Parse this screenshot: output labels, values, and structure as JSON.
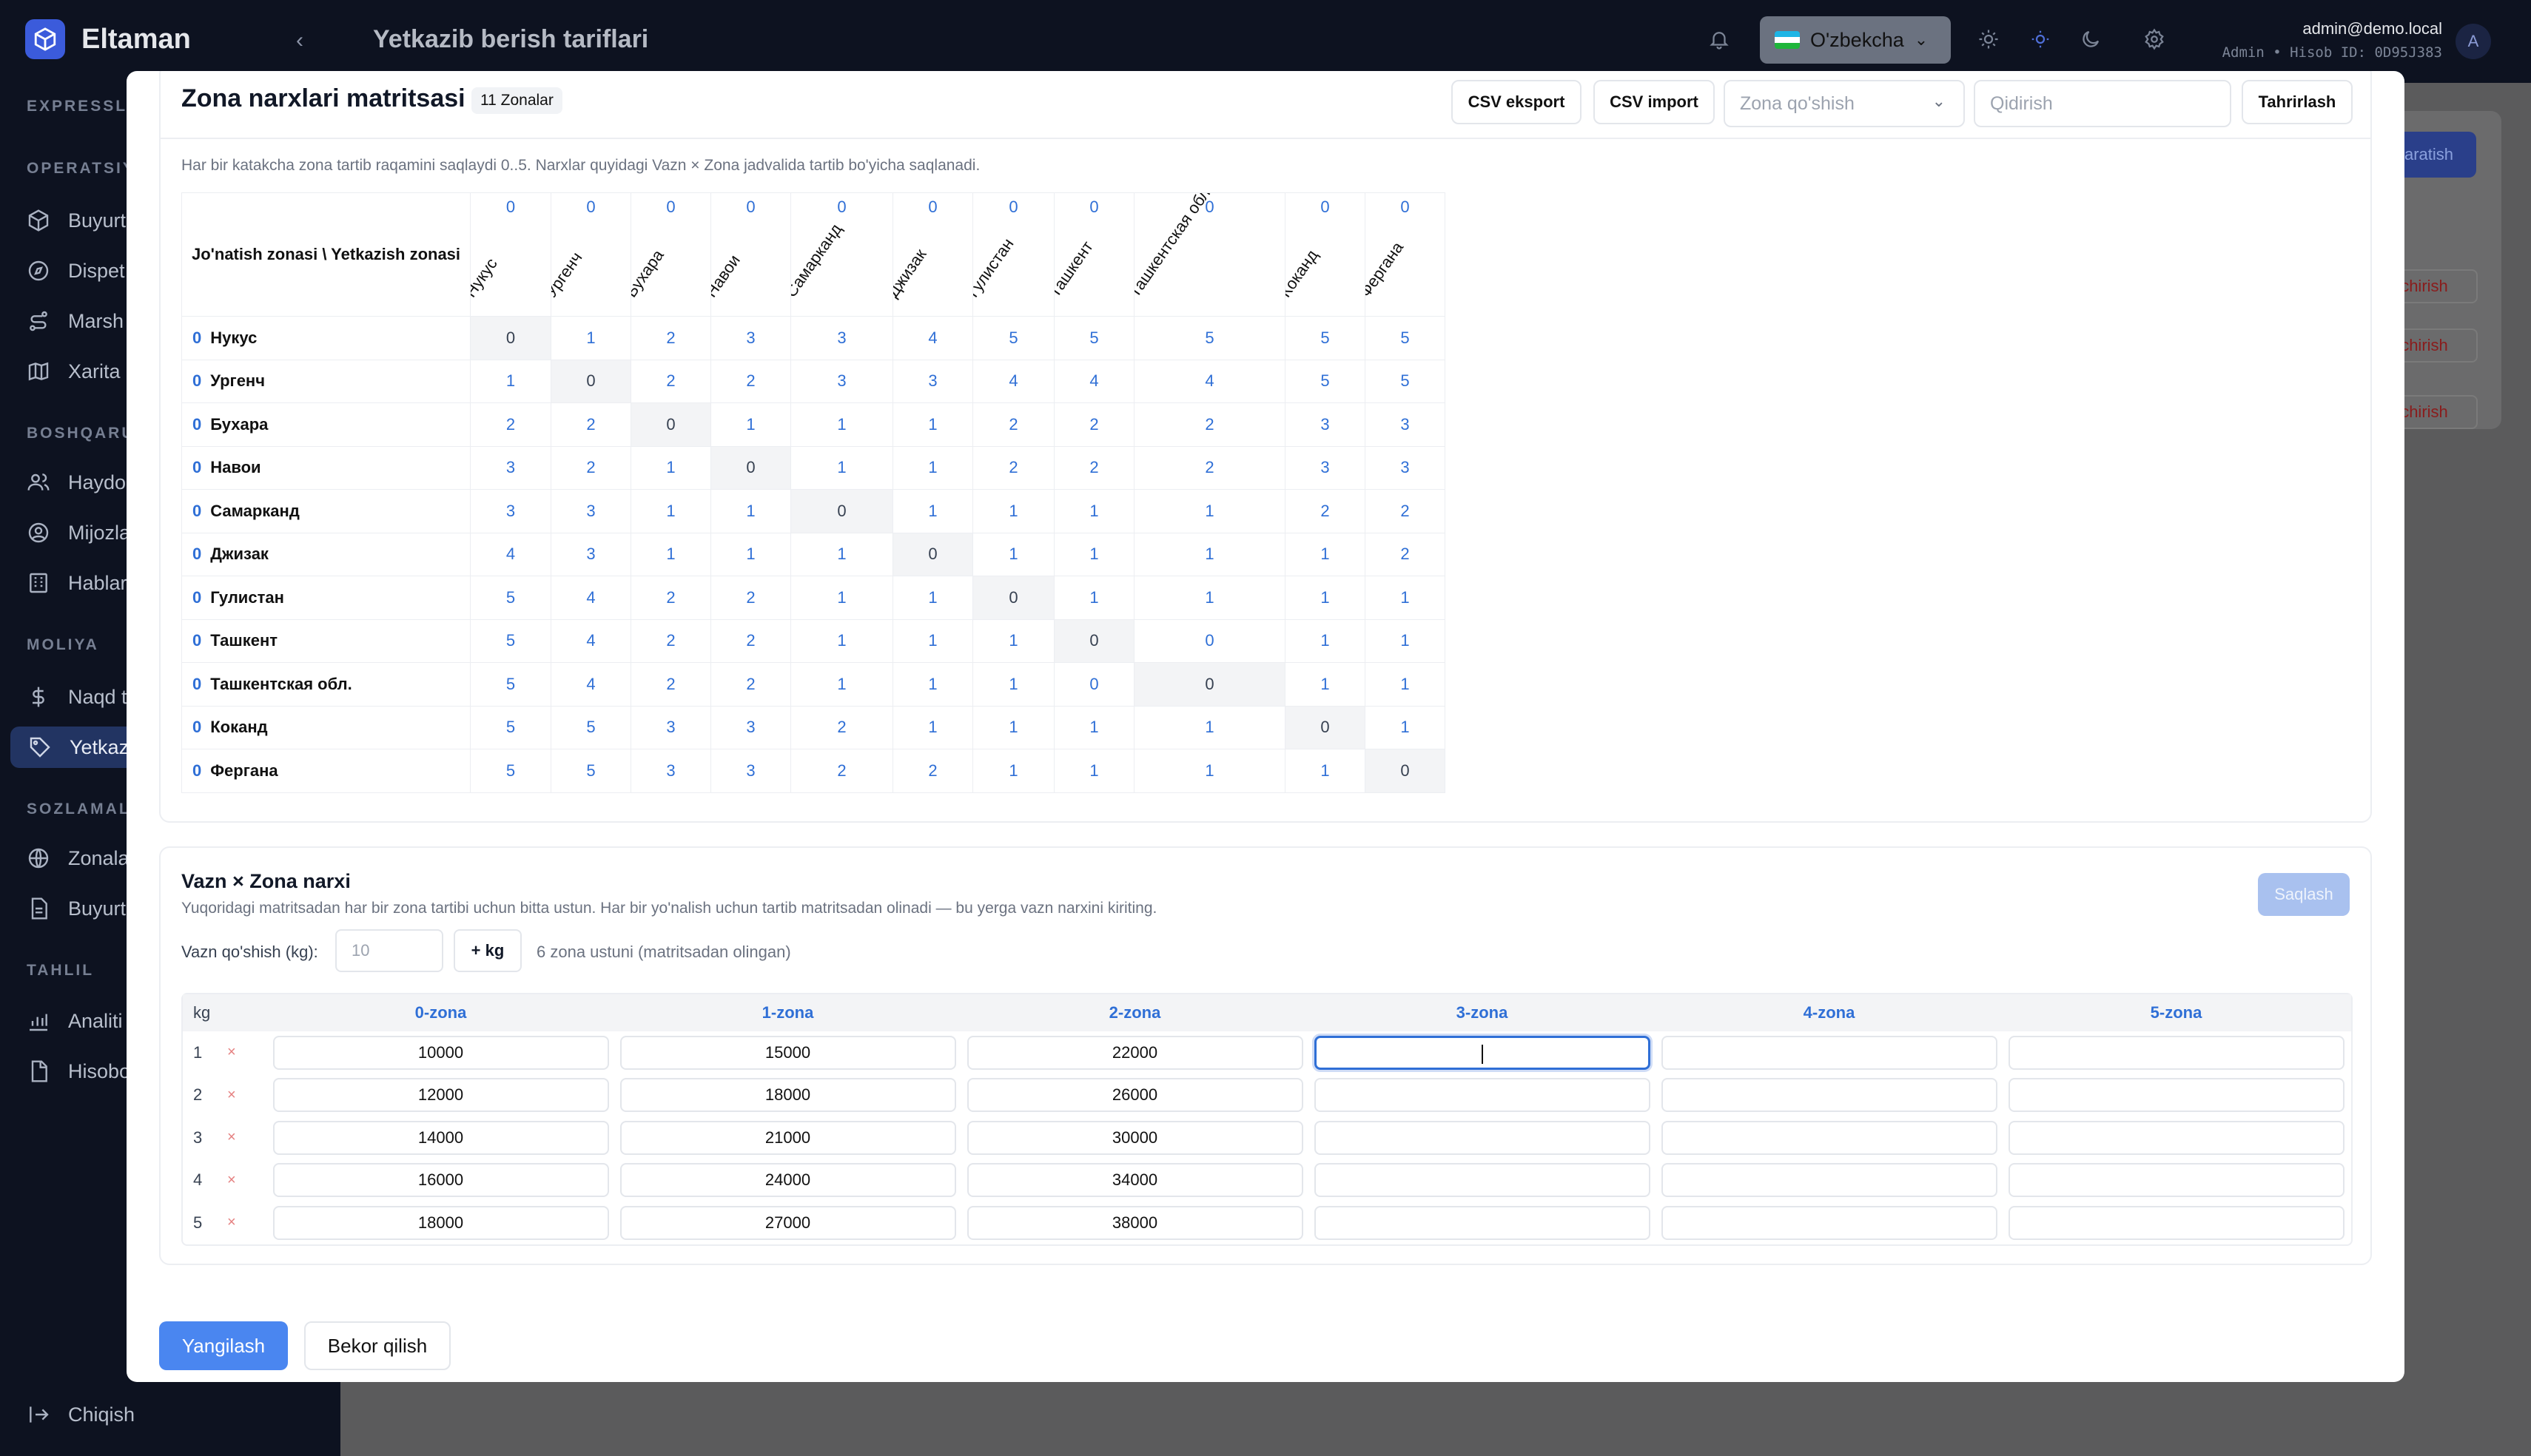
{
  "app": {
    "name": "Eltaman",
    "page_title": "Yetkazib berish tariflari"
  },
  "topbar": {
    "language": "O'zbekcha",
    "email": "admin@demo.local",
    "account": "Admin • Hisob ID: 0D95J383",
    "avatar": "A"
  },
  "sidebar": {
    "sections": [
      {
        "label": "EXPRESSLO",
        "items": []
      },
      {
        "label": "OPERATSIYA",
        "items": [
          {
            "label": "Buyurt",
            "icon": "box-icon"
          },
          {
            "label": "Dispet",
            "icon": "compass-icon"
          },
          {
            "label": "Marsh",
            "icon": "route-icon"
          },
          {
            "label": "Xarita",
            "icon": "map-icon"
          }
        ]
      },
      {
        "label": "BOSHQARU",
        "items": [
          {
            "label": "Haydo",
            "icon": "users-icon"
          },
          {
            "label": "Mijozla",
            "icon": "user-circle-icon"
          },
          {
            "label": "Hablar",
            "icon": "building-icon"
          }
        ]
      },
      {
        "label": "MOLIYA",
        "items": [
          {
            "label": "Naqd t",
            "icon": "dollar-icon"
          },
          {
            "label": "Yetkaz",
            "icon": "tag-icon"
          }
        ]
      },
      {
        "label": "SOZLAMALA",
        "items": [
          {
            "label": "Zonala",
            "icon": "globe-icon"
          },
          {
            "label": "Buyurt",
            "icon": "file-icon"
          }
        ]
      },
      {
        "label": "TAHLIL",
        "items": [
          {
            "label": "Analiti",
            "icon": "chart-icon"
          },
          {
            "label": "Hisobo",
            "icon": "document-icon"
          }
        ]
      }
    ],
    "logout": "Chiqish"
  },
  "background": {
    "add_button": "yaratish",
    "delete_label": "'chirish"
  },
  "modal": {
    "title": "Zona narxlari matritsasi",
    "zone_count_badge": "11 Zonalar",
    "buttons": {
      "csv_export": "CSV eksport",
      "csv_import": "CSV import",
      "edit": "Tahrirlash"
    },
    "add_zone_placeholder": "Zona qo'shish",
    "search_placeholder": "Qidirish",
    "hint": "Har bir katakcha zona tartib raqamini saqlaydi 0..5. Narxlar quyidagi Vazn × Zona jadvalida tartib bo'yicha saqlanadi.",
    "matrix": {
      "corner": "Jo'natish zonasi \\ Yetkazish zonasi",
      "zones": [
        "Нукус",
        "Ургенч",
        "Бухара",
        "Навои",
        "Самарканд",
        "Джизак",
        "Гулистан",
        "Ташкент",
        "Ташкентская обл.",
        "Коканд",
        "Фергана"
      ],
      "zone_index": "0",
      "rows": [
        [
          0,
          1,
          2,
          3,
          3,
          4,
          5,
          5,
          5,
          5,
          5
        ],
        [
          1,
          0,
          2,
          2,
          3,
          3,
          4,
          4,
          4,
          5,
          5
        ],
        [
          2,
          2,
          0,
          1,
          1,
          1,
          2,
          2,
          2,
          3,
          3
        ],
        [
          3,
          2,
          1,
          0,
          1,
          1,
          2,
          2,
          2,
          3,
          3
        ],
        [
          3,
          3,
          1,
          1,
          0,
          1,
          1,
          1,
          1,
          2,
          2
        ],
        [
          4,
          3,
          1,
          1,
          1,
          0,
          1,
          1,
          1,
          1,
          2
        ],
        [
          5,
          4,
          2,
          2,
          1,
          1,
          0,
          1,
          1,
          1,
          1
        ],
        [
          5,
          4,
          2,
          2,
          1,
          1,
          1,
          0,
          0,
          1,
          1
        ],
        [
          5,
          4,
          2,
          2,
          1,
          1,
          1,
          0,
          0,
          1,
          1
        ],
        [
          5,
          5,
          3,
          3,
          2,
          1,
          1,
          1,
          1,
          0,
          1
        ],
        [
          5,
          5,
          3,
          3,
          2,
          2,
          1,
          1,
          1,
          1,
          0
        ]
      ]
    },
    "weight": {
      "title": "Vazn × Zona narxi",
      "subtitle": "Yuqoridagi matritsadan har bir zona tartibi uchun bitta ustun. Har bir yo'nalish uchun tartib matritsadan olinadi — bu yerga vazn narxini kiriting.",
      "save": "Saqlash",
      "add_label": "Vazn qo'shish (kg):",
      "add_placeholder": "10",
      "add_button": "+ kg",
      "note": "6 zona ustuni (matritsadan olingan)",
      "kg_header": "kg",
      "remove_glyph": "×",
      "zone_headers": [
        "0-zona",
        "1-zona",
        "2-zona",
        "3-zona",
        "4-zona",
        "5-zona"
      ],
      "rows": [
        {
          "kg": "1",
          "prices": [
            "10000",
            "15000",
            "22000",
            "",
            "",
            ""
          ]
        },
        {
          "kg": "2",
          "prices": [
            "12000",
            "18000",
            "26000",
            "",
            "",
            ""
          ]
        },
        {
          "kg": "3",
          "prices": [
            "14000",
            "21000",
            "30000",
            "",
            "",
            ""
          ]
        },
        {
          "kg": "4",
          "prices": [
            "16000",
            "24000",
            "34000",
            "",
            "",
            ""
          ]
        },
        {
          "kg": "5",
          "prices": [
            "18000",
            "27000",
            "38000",
            "",
            "",
            ""
          ]
        }
      ]
    },
    "footer": {
      "refresh": "Yangilash",
      "cancel": "Bekor qilish"
    }
  },
  "colors": {
    "accent": "#3b82f6",
    "zone_blue": "#2f6fd6",
    "sidebar_bg": "#0d1220"
  }
}
